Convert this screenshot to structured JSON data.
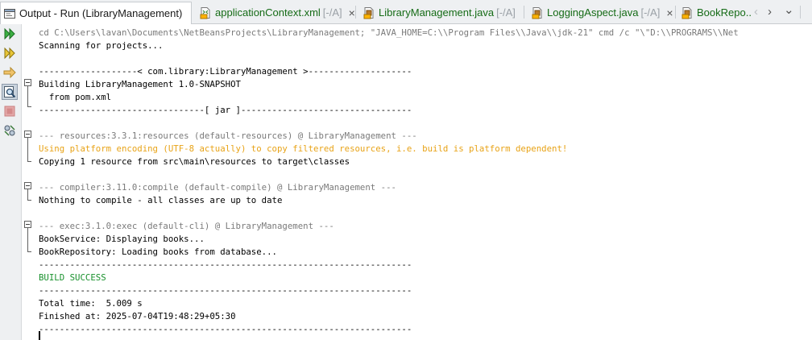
{
  "tabs": [
    {
      "label": "Output - Run (LibraryManagement)",
      "suffix": "",
      "icon": "output-window-icon",
      "active": true,
      "close": "×"
    },
    {
      "label": "applicationContext.xml",
      "suffix": "[-/A]",
      "icon": "xml-file-icon",
      "active": false,
      "close": "×"
    },
    {
      "label": "LibraryManagement.java",
      "suffix": "[-/A]",
      "icon": "java-file-icon",
      "active": false,
      "close": "×"
    },
    {
      "label": "LoggingAspect.java",
      "suffix": "[-/A]",
      "icon": "java-file-icon",
      "active": false,
      "close": "×"
    },
    {
      "label": "BookRepo...",
      "suffix": "",
      "icon": "java-file-icon",
      "active": false,
      "close": ""
    }
  ],
  "tab_nav": {
    "prev": "‹",
    "next": "›",
    "menu": "⌄"
  },
  "toolbar": [
    {
      "name": "rerun-icon"
    },
    {
      "name": "rerun-with-options-icon"
    },
    {
      "name": "apply-code-changes-icon"
    },
    {
      "name": "find-output-icon"
    },
    {
      "name": "stop-icon"
    },
    {
      "name": "output-settings-icon"
    }
  ],
  "output": {
    "lines": [
      {
        "text": "cd C:\\Users\\lavan\\Documents\\NetBeansProjects\\LibraryManagement; \"JAVA_HOME=C:\\\\Program Files\\\\Java\\\\jdk-21\" cmd /c \"\\\"D:\\\\PROGRAMS\\\\Net",
        "style": "gray"
      },
      {
        "text": "Scanning for projects...",
        "style": "normal"
      },
      {
        "text": "",
        "style": "normal"
      },
      {
        "text": "-------------------< com.library:LibraryManagement >--------------------",
        "style": "normal"
      },
      {
        "text": "Building LibraryManagement 1.0-SNAPSHOT",
        "style": "normal"
      },
      {
        "text": "  from pom.xml",
        "style": "normal"
      },
      {
        "text": "--------------------------------[ jar ]---------------------------------",
        "style": "normal"
      },
      {
        "text": "",
        "style": "normal"
      },
      {
        "text": "--- resources:3.3.1:resources (default-resources) @ LibraryManagement ---",
        "style": "gray"
      },
      {
        "text": "Using platform encoding (UTF-8 actually) to copy filtered resources, i.e. build is platform dependent!",
        "style": "warn"
      },
      {
        "text": "Copying 1 resource from src\\main\\resources to target\\classes",
        "style": "normal"
      },
      {
        "text": "",
        "style": "normal"
      },
      {
        "text": "--- compiler:3.11.0:compile (default-compile) @ LibraryManagement ---",
        "style": "gray"
      },
      {
        "text": "Nothing to compile - all classes are up to date",
        "style": "normal"
      },
      {
        "text": "",
        "style": "normal"
      },
      {
        "text": "--- exec:3.1.0:exec (default-cli) @ LibraryManagement ---",
        "style": "gray"
      },
      {
        "text": "BookService: Displaying books...",
        "style": "normal"
      },
      {
        "text": "BookRepository: Loading books from database...",
        "style": "normal"
      },
      {
        "text": "------------------------------------------------------------------------",
        "style": "normal"
      },
      {
        "text": "BUILD SUCCESS",
        "style": "ok"
      },
      {
        "text": "------------------------------------------------------------------------",
        "style": "normal"
      },
      {
        "text": "Total time:  5.009 s",
        "style": "normal"
      },
      {
        "text": "Finished at: 2025-07-04T19:48:29+05:30",
        "style": "normal"
      },
      {
        "text": "------------------------------------------------------------------------",
        "style": "normal"
      }
    ]
  },
  "colors": {
    "success": "#19912d",
    "warning": "#e8a317",
    "info": "#7a7a7a",
    "tab_green": "#156b16"
  }
}
